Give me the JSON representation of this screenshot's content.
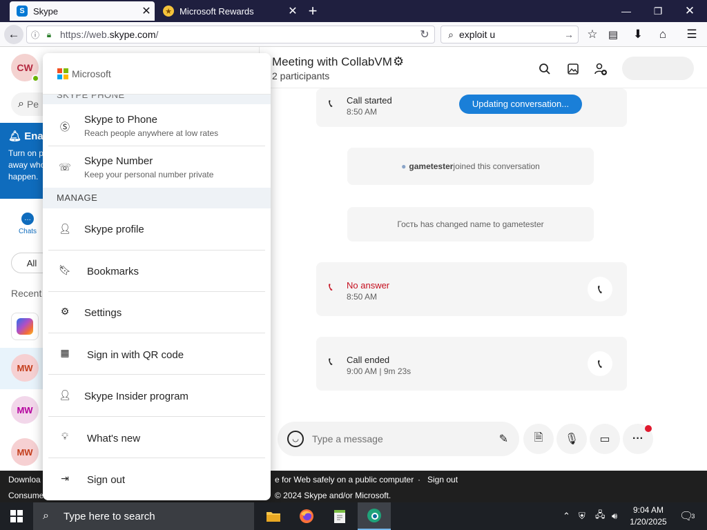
{
  "browser": {
    "tabs": [
      {
        "title": "Skype",
        "favicon": "S"
      },
      {
        "title": "Microsoft Rewards"
      }
    ],
    "url_prefix": "https://web.",
    "url_domain": "skype.com",
    "url_suffix": "/",
    "search_value": "exploit u"
  },
  "skype": {
    "me_initials": "CW",
    "people_search_placeholder": "Pe",
    "notification": {
      "title": "Ena",
      "body_lines": [
        "Turn on p",
        "away who",
        "happen."
      ]
    },
    "nav_chats_label": "Chats",
    "filter_all": "All",
    "recent_label": "Recent",
    "chat_initials": [
      "MW",
      "MW",
      "MW"
    ]
  },
  "conversation": {
    "title": "Meeting with CollabVM",
    "subtitle": "2 participants",
    "call_started": {
      "label": "Call started",
      "time": "8:50 AM",
      "updating": "Updating conversation..."
    },
    "joined": {
      "user": "gametester",
      "text": " joined this conversation"
    },
    "renamed": "Гость has changed name to gametester",
    "no_answer": {
      "label": "No answer",
      "time": "8:50 AM"
    },
    "call_ended": {
      "label": "Call ended",
      "time": "9:00 AM | 9m 23s"
    },
    "composer_placeholder": "Type a message"
  },
  "menu": {
    "brand": "Microsoft",
    "section_phone": "SKYPE PHONE",
    "skype_to_phone": {
      "label": "Skype to Phone",
      "sub": "Reach people anywhere at low rates"
    },
    "skype_number": {
      "label": "Skype Number",
      "sub": "Keep your personal number private"
    },
    "section_manage": "MANAGE",
    "items": [
      "Skype profile",
      "Bookmarks",
      "Settings",
      "Sign in with QR code",
      "Skype Insider program",
      "What's new",
      "Sign out"
    ]
  },
  "footer": {
    "line1_left": "Downloa",
    "line1_mid": "e for Web safely on a public computer",
    "line1_sep": "·",
    "line1_signout": "Sign out",
    "line2_left": "Consume",
    "line2_mid": "© 2024 Skype and/or Microsoft."
  },
  "taskbar": {
    "search_placeholder": "Type here to search",
    "time": "9:04 AM",
    "date": "1/20/2025",
    "notification_count": "3"
  },
  "colors": {
    "skype_blue": "#0078d4",
    "notification_blue": "#0f6cbd",
    "missed_call_red": "#c50f1f",
    "presence_green": "#6bb700"
  }
}
